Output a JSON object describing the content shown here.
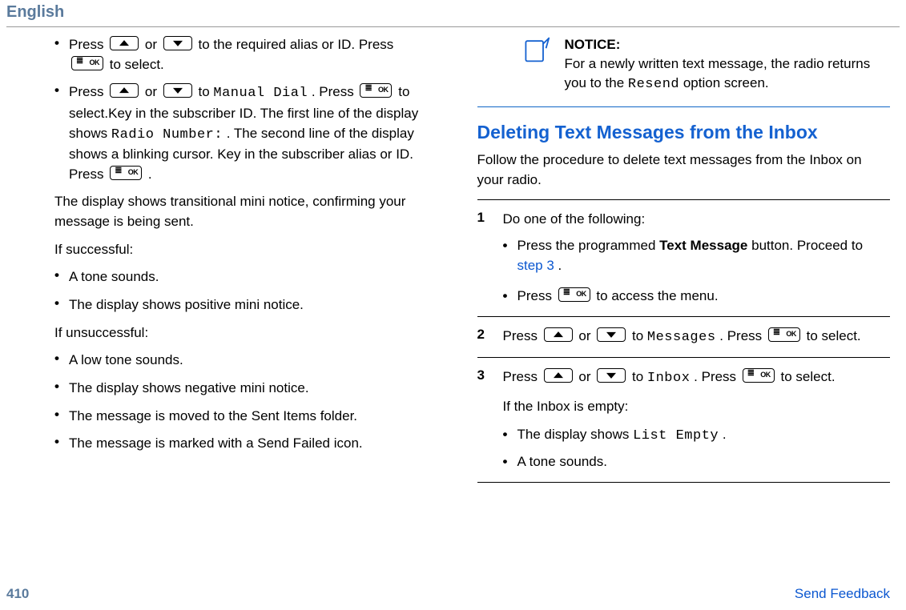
{
  "header": {
    "language": "English"
  },
  "left": {
    "b1_pre": "Press ",
    "b1_mid": " or ",
    "b1_post1": " to the required alias or ID. Press ",
    "b1_post2": " to select.",
    "b2_pre": "Press ",
    "b2_mid": " or ",
    "b2_to": " to ",
    "manual_dial": "Manual Dial",
    "b2_after1": ". Press ",
    "b2_after2": " to select.Key in the subscriber ID. The first line of the display shows ",
    "radio_number": "Radio Number:",
    "b2_after3": ". The second line of the display shows a blinking cursor. Key in the subscriber alias or ID. Press ",
    "b2_after4": " .",
    "transitional": "The display shows transitional mini notice, confirming your message is being sent.",
    "if_success": "If successful:",
    "s1": "A tone sounds.",
    "s2": "The display shows positive mini notice.",
    "if_unsuccess": "If unsuccessful:",
    "u1": "A low tone sounds.",
    "u2": "The display shows negative mini notice.",
    "u3": "The message is moved to the Sent Items folder.",
    "u4": "The message is marked with a Send Failed icon."
  },
  "right": {
    "notice_title": "NOTICE:",
    "notice_pre": "For a newly written text message, the radio returns you to the ",
    "resend": "Resend",
    "notice_post": " option screen.",
    "heading": "Deleting Text Messages from the Inbox",
    "intro": "Follow the procedure to delete text messages from the Inbox on your radio.",
    "step1_intro": "Do one of the following:",
    "step1_b1_pre": "Press the programmed ",
    "text_message": "Text Message",
    "step1_b1_mid": " button. Proceed to ",
    "step3_link": "step 3",
    "step1_b1_post": ".",
    "step1_b2_pre": "Press ",
    "step1_b2_post": " to access the menu.",
    "step2_pre": "Press ",
    "step2_mid": " or ",
    "step2_to": " to ",
    "messages": "Messages",
    "step2_after1": ". Press ",
    "step2_after2": " to select.",
    "step3_pre": "Press ",
    "step3_mid": " or ",
    "step3_to": " to ",
    "inbox": "Inbox",
    "step3_after1": ". Press ",
    "step3_after2": " to select.",
    "step3_empty": "If the Inbox is empty:",
    "step3_b1_pre": "The display shows ",
    "list_empty": "List Empty",
    "step3_b1_post": ".",
    "step3_b2": "A tone sounds."
  },
  "footer": {
    "page": "410",
    "feedback": "Send Feedback"
  }
}
